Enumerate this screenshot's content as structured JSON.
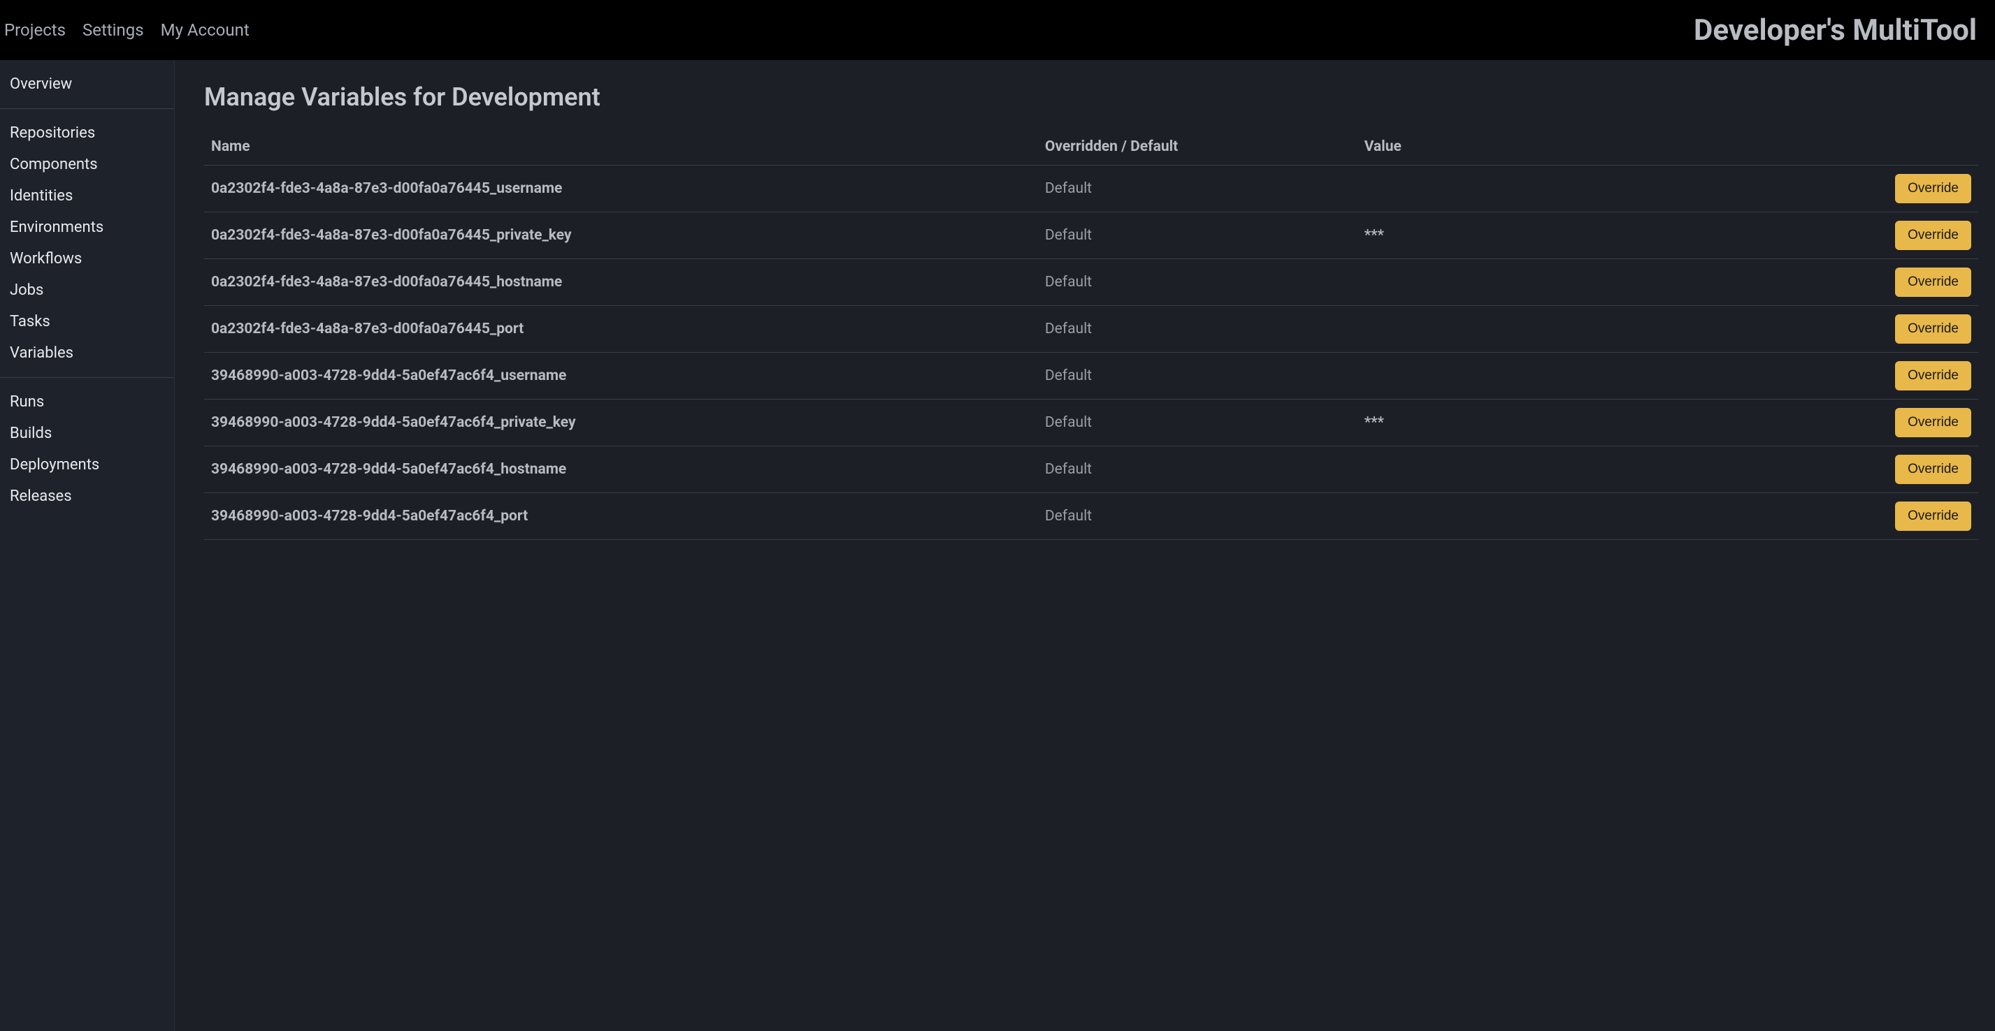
{
  "header": {
    "nav": {
      "projects": "Projects",
      "settings": "Settings",
      "account": "My Account"
    },
    "title": "Developer's MultiTool"
  },
  "sidebar": {
    "section1": {
      "overview": "Overview"
    },
    "section2": {
      "repositories": "Repositories",
      "components": "Components",
      "identities": "Identities",
      "environments": "Environments",
      "workflows": "Workflows",
      "jobs": "Jobs",
      "tasks": "Tasks",
      "variables": "Variables"
    },
    "section3": {
      "runs": "Runs",
      "builds": "Builds",
      "deployments": "Deployments",
      "releases": "Releases"
    }
  },
  "main": {
    "title": "Manage Variables for Development",
    "columns": {
      "name": "Name",
      "status": "Overridden / Default",
      "value": "Value"
    },
    "override_label": "Override",
    "rows": [
      {
        "name": "0a2302f4-fde3-4a8a-87e3-d00fa0a76445_username",
        "status": "Default",
        "value": ""
      },
      {
        "name": "0a2302f4-fde3-4a8a-87e3-d00fa0a76445_private_key",
        "status": "Default",
        "value": "***"
      },
      {
        "name": "0a2302f4-fde3-4a8a-87e3-d00fa0a76445_hostname",
        "status": "Default",
        "value": ""
      },
      {
        "name": "0a2302f4-fde3-4a8a-87e3-d00fa0a76445_port",
        "status": "Default",
        "value": ""
      },
      {
        "name": "39468990-a003-4728-9dd4-5a0ef47ac6f4_username",
        "status": "Default",
        "value": ""
      },
      {
        "name": "39468990-a003-4728-9dd4-5a0ef47ac6f4_private_key",
        "status": "Default",
        "value": "***"
      },
      {
        "name": "39468990-a003-4728-9dd4-5a0ef47ac6f4_hostname",
        "status": "Default",
        "value": ""
      },
      {
        "name": "39468990-a003-4728-9dd4-5a0ef47ac6f4_port",
        "status": "Default",
        "value": ""
      }
    ]
  }
}
